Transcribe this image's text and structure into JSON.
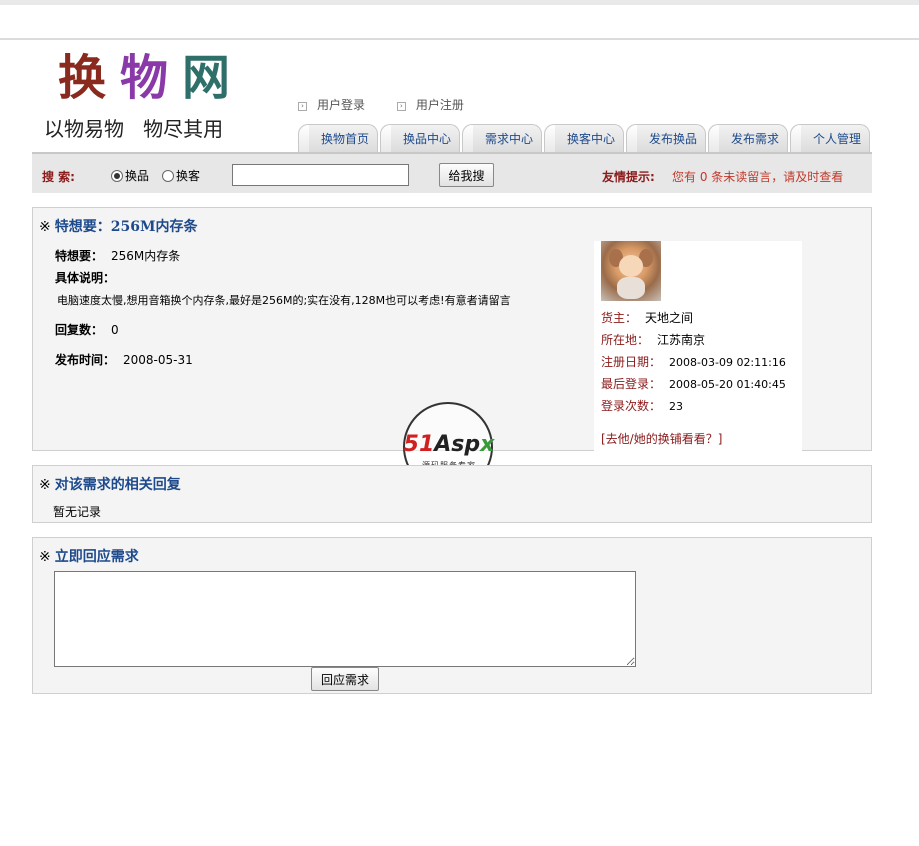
{
  "site": {
    "logo_chars": [
      "换",
      "物",
      "网"
    ],
    "slogan": "以物易物   物尽其用",
    "colors": {
      "logo1": "#8a2a1f",
      "logo2": "#8a3aa8",
      "logo3": "#2f6f6a",
      "tab_text": "#1e4a8c",
      "accent_red": "#8b1a1a"
    }
  },
  "header": {
    "login_link": "用户登录",
    "register_link": "用户注册",
    "link_icon": "arrow-box-icon"
  },
  "nav": {
    "tabs": [
      "换物首页",
      "换品中心",
      "需求中心",
      "换客中心",
      "发布换品",
      "发布需求",
      "个人管理"
    ]
  },
  "search": {
    "label": "搜  索:",
    "option_goods": "换品",
    "option_users": "换客",
    "selected": "换品",
    "input_value": "",
    "button": "给我搜",
    "tip_label": "友情提示:",
    "tip_text": "您有 0 条未读留言，请及时查看"
  },
  "demand": {
    "title": "特想要：256M内存条",
    "title_mark": "※",
    "want_label": "特想要：",
    "want_value": "256M内存条",
    "desc_label": "具体说明：",
    "desc_value": "电脑速度太慢,想用音箱换个内存条,最好是256M的;实在没有,128M也可以考虑!有意者请留言",
    "reply_label": "回复数：",
    "reply_value": "0",
    "date_label": "发布时间：",
    "date_value": "2008-05-31"
  },
  "owner": {
    "avatar_icon": "dog-avatar-icon",
    "owner_label": "货主：",
    "owner_value": "天地之间",
    "location_label": "所在地：",
    "location_value": "江苏南京",
    "reg_label": "注册日期：",
    "reg_value": "2008-03-09 02:11:16",
    "last_label": "最后登录：",
    "last_value": "2008-05-20 01:40:45",
    "count_label": "登录次数：",
    "count_value": "23",
    "shop_link": "[去他/她的换铺看看？]"
  },
  "watermark": {
    "brand_a": "51",
    "brand_b": "Asp",
    "brand_c": "x",
    "sub": "源码服务专家"
  },
  "replies": {
    "title_mark": "※",
    "title": "对该需求的相关回复",
    "empty_text": "暂无记录"
  },
  "respond": {
    "title_mark": "※",
    "title": "立即回应需求",
    "textarea_value": "",
    "button": "回应需求"
  }
}
